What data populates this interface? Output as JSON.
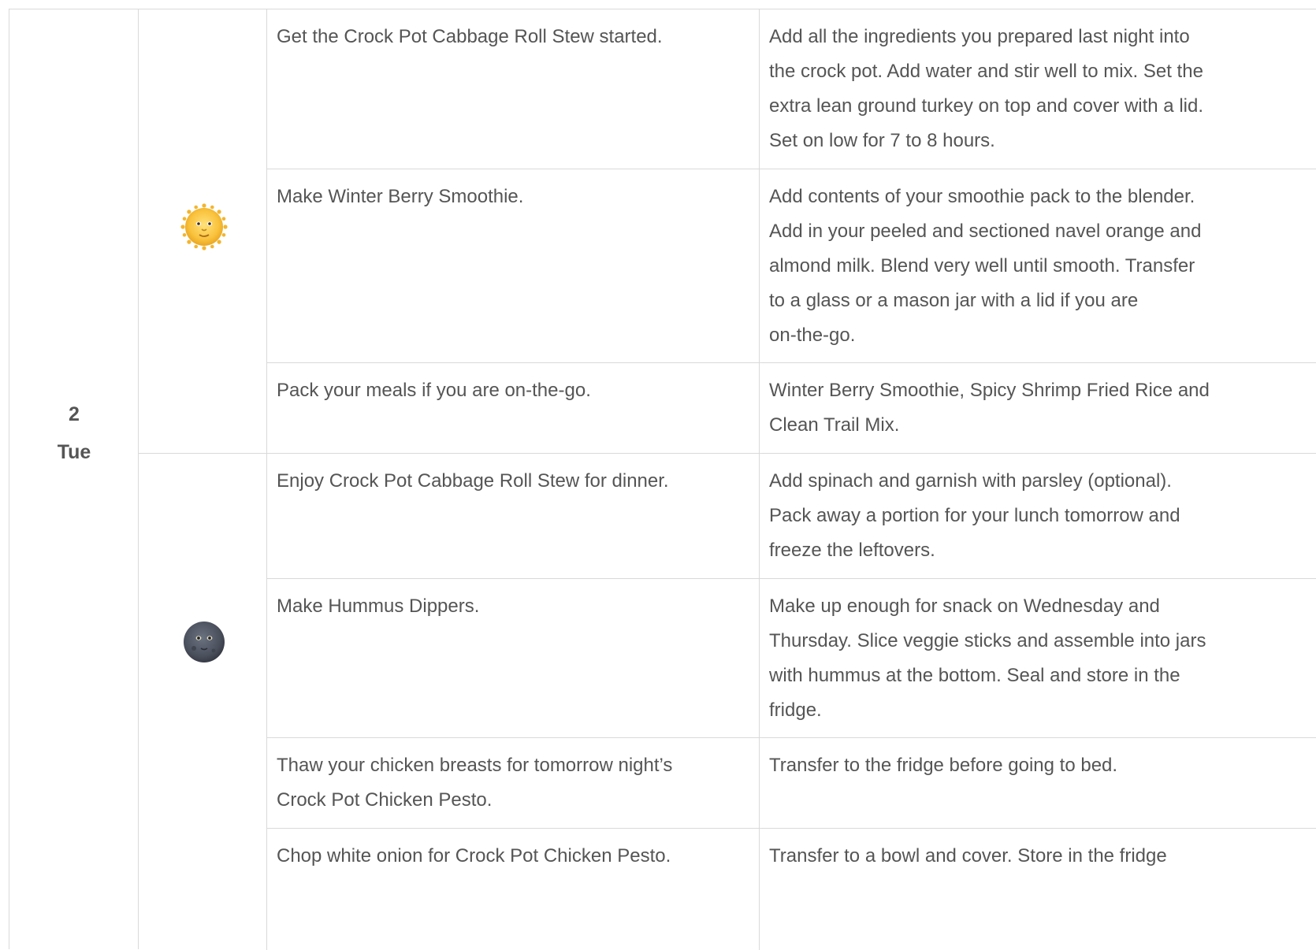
{
  "day": {
    "number": "2",
    "name": "Tue"
  },
  "periods": [
    {
      "icon": "sun-face-icon"
    },
    {
      "icon": "new-moon-face-icon"
    }
  ],
  "rows": [
    {
      "task": "Get the Crock Pot Cabbage Roll Stew started.",
      "note": "Add all the ingredients you prepared last night into\nthe crock pot. Add water and stir well to mix. Set the\nextra lean ground turkey on top and cover with a lid.\nSet on low for 7 to 8 hours."
    },
    {
      "task": "Make Winter Berry Smoothie.",
      "note": "Add contents of your smoothie pack to the blender.\nAdd in your peeled and sectioned navel orange and\nalmond milk. Blend very well until smooth. Transfer\nto a glass or a mason jar with a lid if you are\non-the-go."
    },
    {
      "task": "Pack your meals if you are on-the-go.",
      "note": "Winter Berry Smoothie, Spicy Shrimp Fried Rice and\nClean Trail Mix."
    },
    {
      "task": "Enjoy Crock Pot Cabbage Roll Stew for dinner.",
      "note": "Add spinach and garnish with parsley (optional).\nPack away a portion for your lunch tomorrow and\nfreeze the leftovers."
    },
    {
      "task": "Make Hummus Dippers.",
      "note": "Make up enough for snack on Wednesday and\nThursday. Slice veggie sticks and assemble into jars\nwith hummus at the bottom. Seal and store in the\nfridge."
    },
    {
      "task": "Thaw your chicken breasts for tomorrow night’s\nCrock Pot Chicken Pesto.",
      "note": "Transfer to the fridge before going to bed."
    },
    {
      "task": "Chop white onion for Crock Pot Chicken Pesto.",
      "note": "Transfer to a bowl and cover. Store in the fridge"
    }
  ]
}
